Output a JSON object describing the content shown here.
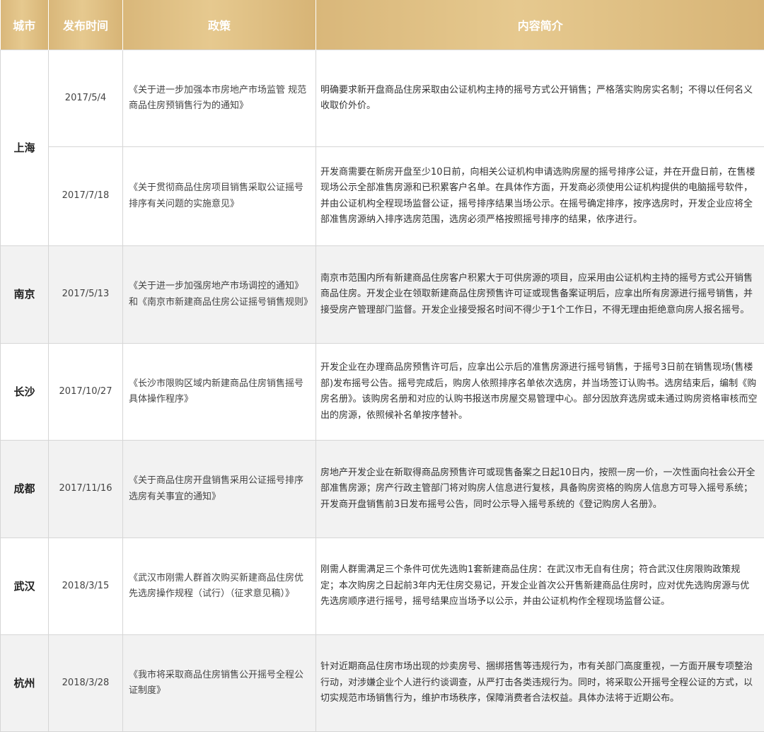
{
  "header": {
    "city": "城市",
    "date": "发布时间",
    "policy": "政策",
    "summary": "内容简介"
  },
  "colors": {
    "header_gold": "#d9b77a",
    "header_text": "#ffffff",
    "shaded_row": "#f2f2f2",
    "border": "#d6d6d6"
  },
  "rows": [
    {
      "city": "上海",
      "date": "2017/5/4",
      "policy": "《关于进一步加强本市房地产市场监管 规范商品住房预销售行为的通知》",
      "summary": "明确要求新开盘商品住房采取由公证机构主持的摇号方式公开销售；严格落实购房实名制；不得以任何名义收取价外价。"
    },
    {
      "date": "2017/7/18",
      "policy": "《关于贯彻商品住房项目销售采取公证摇号排序有关问题的实施意见》",
      "summary": "开发商需要在新房开盘至少10日前，向相关公证机构申请选购房屋的摇号排序公证，并在开盘日前，在售楼现场公示全部准售房源和已积累客户名单。在具体作方面，开发商必须使用公证机构提供的电脑摇号软件，并由公证机构全程现场监督公证，摇号排序结果当场公示。在摇号确定排序，按序选房时，开发企业应将全部准售房源纳入排序选房范围，选房必须严格按照摇号排序的结果，依序进行。"
    },
    {
      "city": "南京",
      "date": "2017/5/13",
      "policy": "《关于进一步加强房地产市场调控的通知》和《南京市新建商品住房公证摇号销售规则》",
      "summary": "南京市范围内所有新建商品住房客户积累大于可供房源的项目，应采用由公证机构主持的摇号方式公开销售商品住房。开发企业在领取新建商品住房预售许可证或现售备案证明后，应拿出所有房源进行摇号销售，并接受房产管理部门监督。开发企业接受报名时间不得少于1个工作日，不得无理由拒绝意向房人报名摇号。"
    },
    {
      "city": "长沙",
      "date": "2017/10/27",
      "policy": "《长沙市限购区域内新建商品住房销售摇号具体操作程序》",
      "summary": "开发企业在办理商品房预售许可后，应拿出公示后的准售房源进行摇号销售，于摇号3日前在销售现场(售楼部)发布摇号公告。摇号完成后，购房人依照排序名单依次选房，并当场签订认购书。选房结束后，编制《购房名册》。该购房名册和对应的认购书报送市房屋交易管理中心。部分因放弃选房或未通过购房资格审核而空出的房源，依照候补名单按序替补。"
    },
    {
      "city": "成都",
      "date": "2017/11/16",
      "policy": "《关于商品住房开盘销售采用公证摇号排序选房有关事宜的通知》",
      "summary": "房地产开发企业在新取得商品房预售许可或现售备案之日起10日内，按照一房一价，一次性面向社会公开全部准售房源；房产行政主管部门将对购房人信息进行复核，具备购房资格的购房人信息方可导入摇号系统；开发商开盘销售前3日发布摇号公告，同时公示导入摇号系统的《登记购房人名册》。"
    },
    {
      "city": "武汉",
      "date": "2018/3/15",
      "policy": "《武汉市刚需人群首次购买新建商品住房优先选房操作规程（试行）（征求意见稿）》",
      "summary": "刚需人群需满足三个条件可优先选购1套新建商品住房：在武汉市无自有住房；符合武汉住房限购政策规定；本次购房之日起前3年内无住房交易记，开发企业首次公开售新建商品住房时，应对优先选购房源与优先选房顺序进行摇号，摇号结果应当场予以公示，并由公证机构作全程现场监督公证。"
    },
    {
      "city": "杭州",
      "date": "2018/3/28",
      "policy": "《我市将采取商品住房销售公开摇号全程公证制度》",
      "summary": "针对近期商品住房市场出现的炒卖房号、捆绑搭售等违规行为，市有关部门高度重视，一方面开展专项整治行动，对涉嫌企业个人进行约谈调查，从严打击各类违规行为。同时，将采取公开摇号全程公证的方式，以切实规范市场销售行为，维护市场秩序，保障消费者合法权益。具体办法将于近期公布。"
    }
  ]
}
